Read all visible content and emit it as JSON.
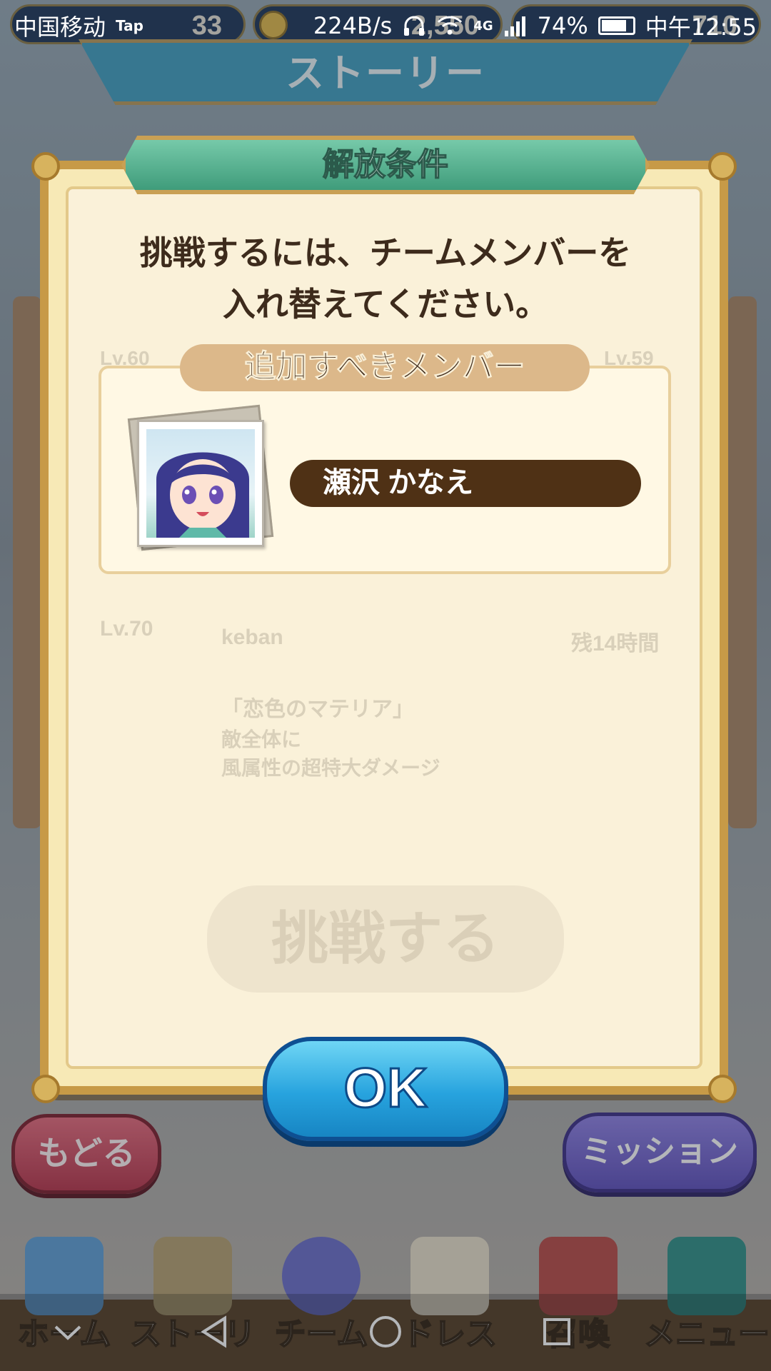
{
  "status_bar": {
    "carrier": "中国移动",
    "carrier_badge": "Tap",
    "net_speed": "224B/s",
    "signal_type": "4G",
    "battery": "74%",
    "time": "中午12:55"
  },
  "hud": {
    "value_1": "33",
    "value_2": "2,550",
    "value_3": "710"
  },
  "screen_title": "ストーリー",
  "dialog": {
    "title": "解放条件",
    "message_line1": "挑戦するには、チームメンバーを",
    "message_line2": "入れ替えてください。",
    "section_label": "追加すべきメンバー",
    "member_name": "瀬沢 かなえ",
    "ok_label": "OK"
  },
  "background_faded": {
    "level_1": "Lv.60",
    "level_2": "Lv.59",
    "level_3": "Lv.70",
    "player_name": "keban",
    "time_left": "残14時間",
    "skill_title": "「恋色のマテリア」",
    "skill_line1": "敵全体に",
    "skill_line2": "風属性の超特大ダメージ",
    "challenge_label": "挑戦する"
  },
  "buttons": {
    "back_label": "もどる",
    "mission_label": "ミッション"
  },
  "bottom_nav": [
    {
      "label": "ホーム",
      "icon": "map-icon"
    },
    {
      "label": "ストーリー",
      "icon": "crown-icon"
    },
    {
      "label": "チーム",
      "icon": "team-icon"
    },
    {
      "label": "ドレス",
      "icon": "dress-icon"
    },
    {
      "label": "召喚",
      "icon": "book-icon"
    },
    {
      "label": "メニュー",
      "icon": "menu-icon"
    }
  ]
}
